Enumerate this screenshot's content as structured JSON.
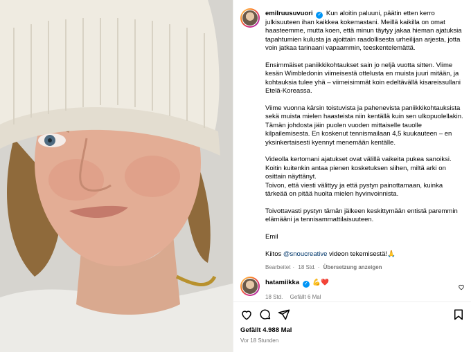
{
  "post": {
    "author": "emilruusuvuori",
    "caption_p1": "Kun aloitin paluuni, päätin etten kerro julkisuuteen ihan kaikkea kokemastani. Meillä kaikilla on omat haasteemme, mutta koen, että minun täytyy jakaa hieman ajatuksia tapahtumien kulusta ja ajoittain raadollisesta urheilijan arjesta, jotta voin jatkaa tarinaani vapaammin, teeskentelemättä.",
    "caption_p2": "Ensimmäiset paniikkikohtaukset sain jo neljä vuotta sitten. Viime kesän Wimbledonin viimeisestä ottelusta en muista juuri mitään, ja kohtauksia tulee yhä – viimeisimmät koin edeltävällä kisareissullani Etelä-Koreassa.",
    "caption_p3": "Viime vuonna kärsin toistuvista ja pahenevista paniikkikohtauksista sekä muista mielen haasteista niin kentällä kuin sen ulkopuolellakin. Tämän johdosta jäin puolen vuoden mittaiselle tauolle kilpailemisesta. En koskenut tennismailaan 4,5 kuukauteen – en yksinkertaisesti kyennyt menemään kentälle.",
    "caption_p4a": "Videolla kertomani ajatukset ovat välillä vaikeita pukea sanoiksi. Koitin kuitenkin antaa pienen kosketuksen siihen, miltä arki on osittain näyttänyt.",
    "caption_p4b": "Toivon, että viesti välittyy ja että pystyn painottamaan, kuinka tärkeää on pitää huolta mielen hyvinvoinnista.",
    "caption_p5": "Toivottavasti pystyn tämän jälkeen keskittymään entistä paremmin elämääni ja tennisammattilaisuuteen.",
    "caption_sign": "Emil",
    "credit_prefix": "Kiitos ",
    "credit_mention": "@snoucreative",
    "credit_suffix": " videon tekemisestä!🙏",
    "meta_edited": "Bearbeitet",
    "meta_dot": "·",
    "meta_time": "18 Std.",
    "meta_translate": "Übersetzung anzeigen"
  },
  "comment": {
    "author": "hatamiikka",
    "text": "💪❤️",
    "time": "18 Std.",
    "likes": "Gefällt 6 Mal"
  },
  "actions": {
    "likes_text": "Gefällt 4.988 Mal",
    "posted_ago": "Vor 18 Stunden"
  },
  "colors": {
    "verified": "#0095f6",
    "mention": "#00376b",
    "secondary": "#737373"
  },
  "icons": [
    "heart-icon",
    "comment-icon",
    "share-icon",
    "bookmark-icon",
    "verified-icon"
  ]
}
